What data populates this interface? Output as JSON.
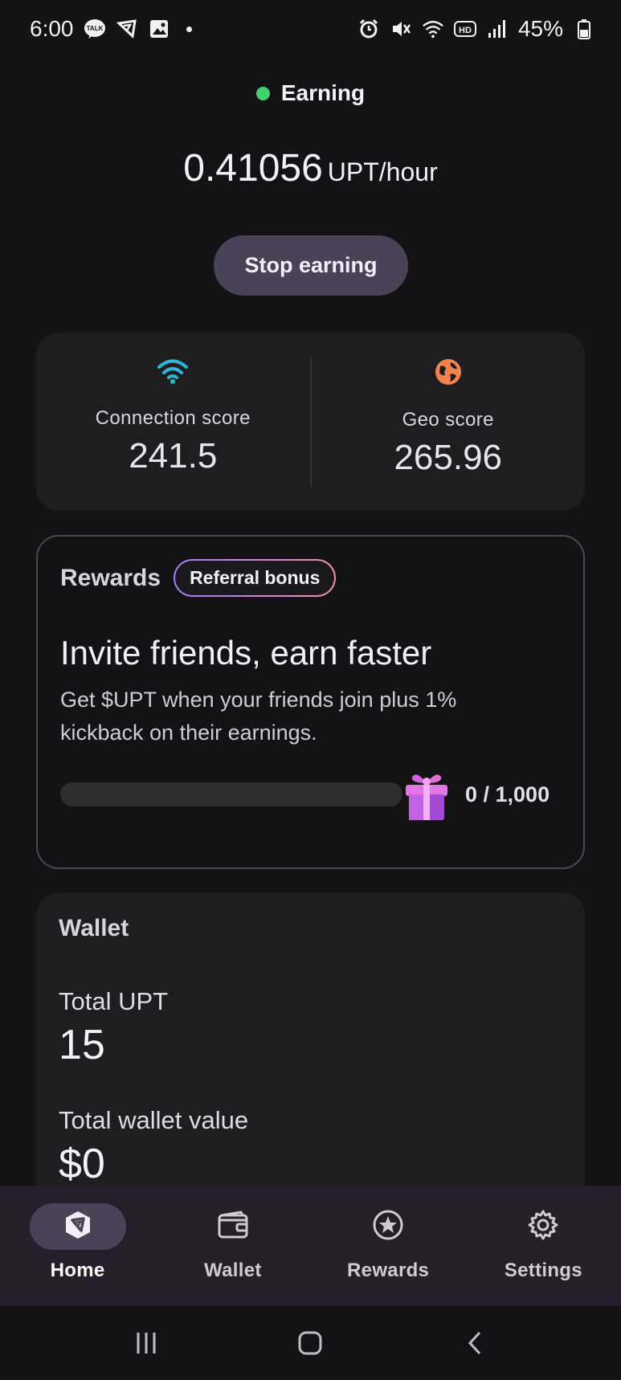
{
  "status_bar": {
    "time": "6:00",
    "battery": "45%",
    "left_icons": [
      "kakaotalk-icon",
      "app-icon",
      "image-icon"
    ],
    "right_icons": [
      "alarm-icon",
      "mute-icon",
      "wifi-icon",
      "hd-icon",
      "signal-icon",
      "battery-icon"
    ]
  },
  "earning": {
    "status": "Earning",
    "status_color": "#3ed36b",
    "rate_value": "0.41056",
    "rate_unit": "UPT/hour",
    "stop_button": "Stop earning"
  },
  "scores": {
    "connection": {
      "label": "Connection score",
      "value": "241.5",
      "icon": "wifi-icon",
      "color": "#2bb6d8"
    },
    "geo": {
      "label": "Geo score",
      "value": "265.96",
      "icon": "globe-icon",
      "color": "#f2834a"
    }
  },
  "rewards": {
    "title": "Rewards",
    "badge": "Referral bonus",
    "headline": "Invite friends, earn faster",
    "description": "Get $UPT when your friends join plus 1% kickback on their earnings.",
    "progress_label": "0 / 1,000",
    "progress_fraction": 0
  },
  "wallet": {
    "title": "Wallet",
    "total_upt_label": "Total UPT",
    "total_upt_value": "15",
    "total_value_label": "Total wallet value",
    "total_value_value": "$0"
  },
  "nav": {
    "items": [
      {
        "label": "Home",
        "icon": "home-logo-icon",
        "active": true
      },
      {
        "label": "Wallet",
        "icon": "wallet-icon",
        "active": false
      },
      {
        "label": "Rewards",
        "icon": "star-circle-icon",
        "active": false
      },
      {
        "label": "Settings",
        "icon": "gear-icon",
        "active": false
      }
    ]
  }
}
